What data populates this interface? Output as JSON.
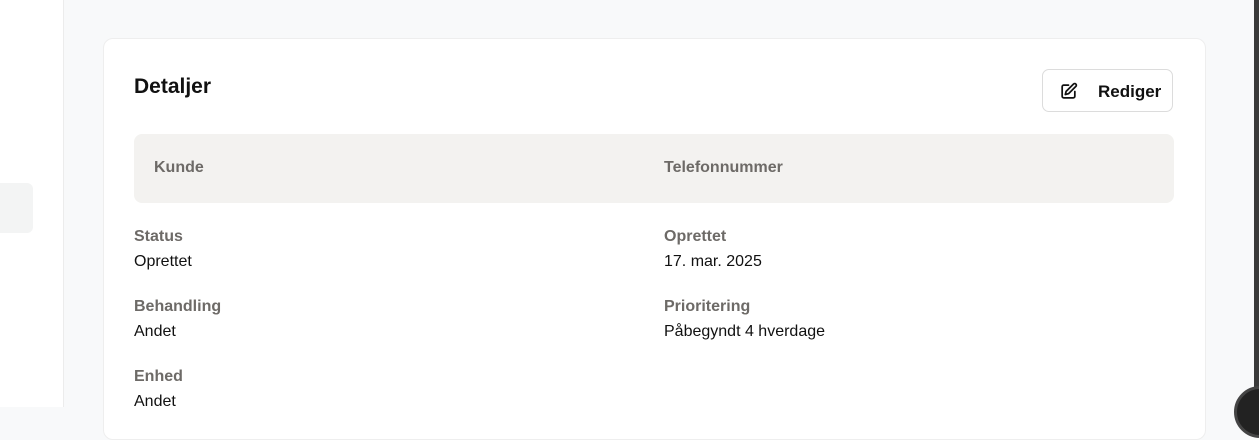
{
  "details": {
    "title": "Detaljer",
    "edit_label": "Rediger",
    "customer_label": "Kunde",
    "phone_label": "Telefonnummer",
    "fields": [
      {
        "label": "Status",
        "value": "Oprettet"
      },
      {
        "label": "Oprettet",
        "value": "17. mar. 2025"
      },
      {
        "label": "Behandling",
        "value": "Andet"
      },
      {
        "label": "Prioritering",
        "value": "Påbegyndt 4 hverdage"
      },
      {
        "label": "Enhed",
        "value": "Andet"
      }
    ]
  },
  "icons": {
    "edit": "pencil-square-icon",
    "chat": "chat-icon"
  }
}
